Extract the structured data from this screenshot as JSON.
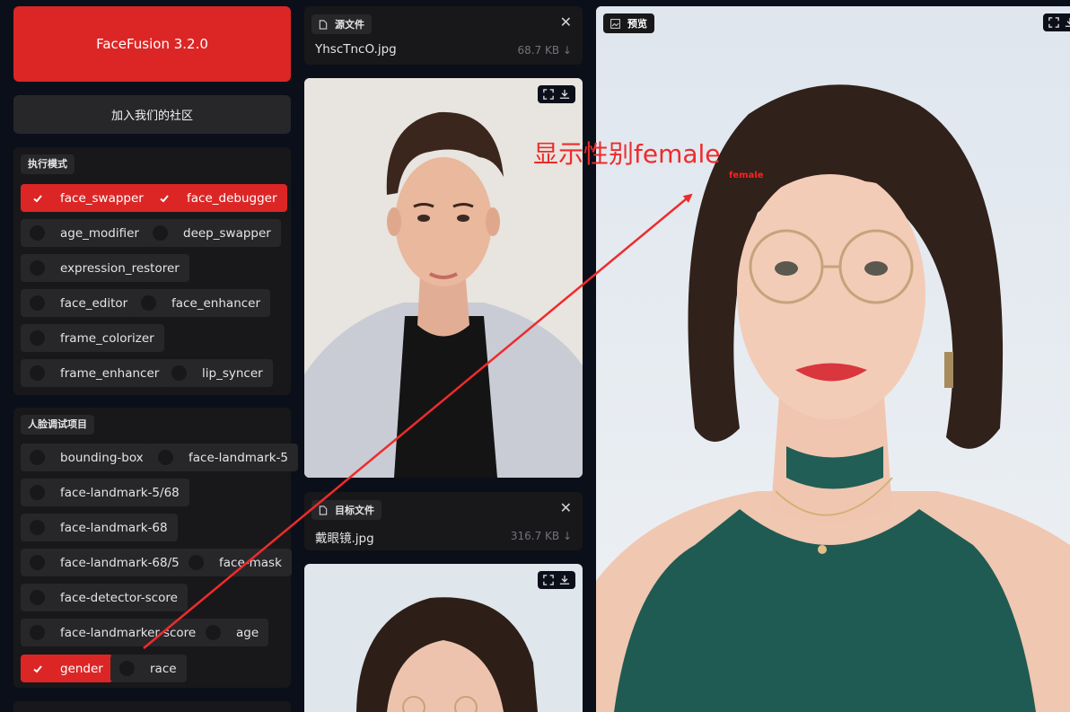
{
  "app": {
    "title": "FaceFusion 3.2.0",
    "community": "加入我们的社区"
  },
  "execution": {
    "label": "执行模式",
    "options": [
      {
        "label": "face_swapper",
        "checked": true
      },
      {
        "label": "face_debugger",
        "checked": true
      },
      {
        "label": "age_modifier",
        "checked": false
      },
      {
        "label": "deep_swapper",
        "checked": false
      },
      {
        "label": "expression_restorer",
        "checked": false
      },
      {
        "label": "face_editor",
        "checked": false
      },
      {
        "label": "face_enhancer",
        "checked": false
      },
      {
        "label": "frame_colorizer",
        "checked": false
      },
      {
        "label": "frame_enhancer",
        "checked": false
      },
      {
        "label": "lip_syncer",
        "checked": false
      }
    ]
  },
  "debug": {
    "label": "人脸调试项目",
    "options": [
      {
        "label": "bounding-box",
        "checked": false
      },
      {
        "label": "face-landmark-5",
        "checked": false
      },
      {
        "label": "face-landmark-5/68",
        "checked": false
      },
      {
        "label": "face-landmark-68",
        "checked": false
      },
      {
        "label": "face-landmark-68/5",
        "checked": false
      },
      {
        "label": "face-mask",
        "checked": false
      },
      {
        "label": "face-detector-score",
        "checked": false
      },
      {
        "label": "face-landmarker-score",
        "checked": false
      },
      {
        "label": "age",
        "checked": false
      },
      {
        "label": "gender",
        "checked": true
      },
      {
        "label": "race",
        "checked": false
      }
    ]
  },
  "source": {
    "label": "源文件",
    "filename": "YhscTncO.jpg",
    "size": "68.7 KB ↓",
    "close": "✕"
  },
  "target": {
    "label": "目标文件",
    "filename": "戴眼镜.jpg",
    "size": "316.7 KB ↓",
    "close": "✕"
  },
  "preview": {
    "label": "预览",
    "overlay_label": "female"
  },
  "annotation": {
    "text": "显示性别female"
  },
  "colors": {
    "accent": "#dc2626",
    "panel": "#18181b",
    "chip": "#27272a",
    "background": "#0b0f19"
  },
  "icons": [
    "check-icon",
    "file-icon",
    "image-icon",
    "close-icon",
    "fullscreen-icon",
    "download-icon"
  ]
}
